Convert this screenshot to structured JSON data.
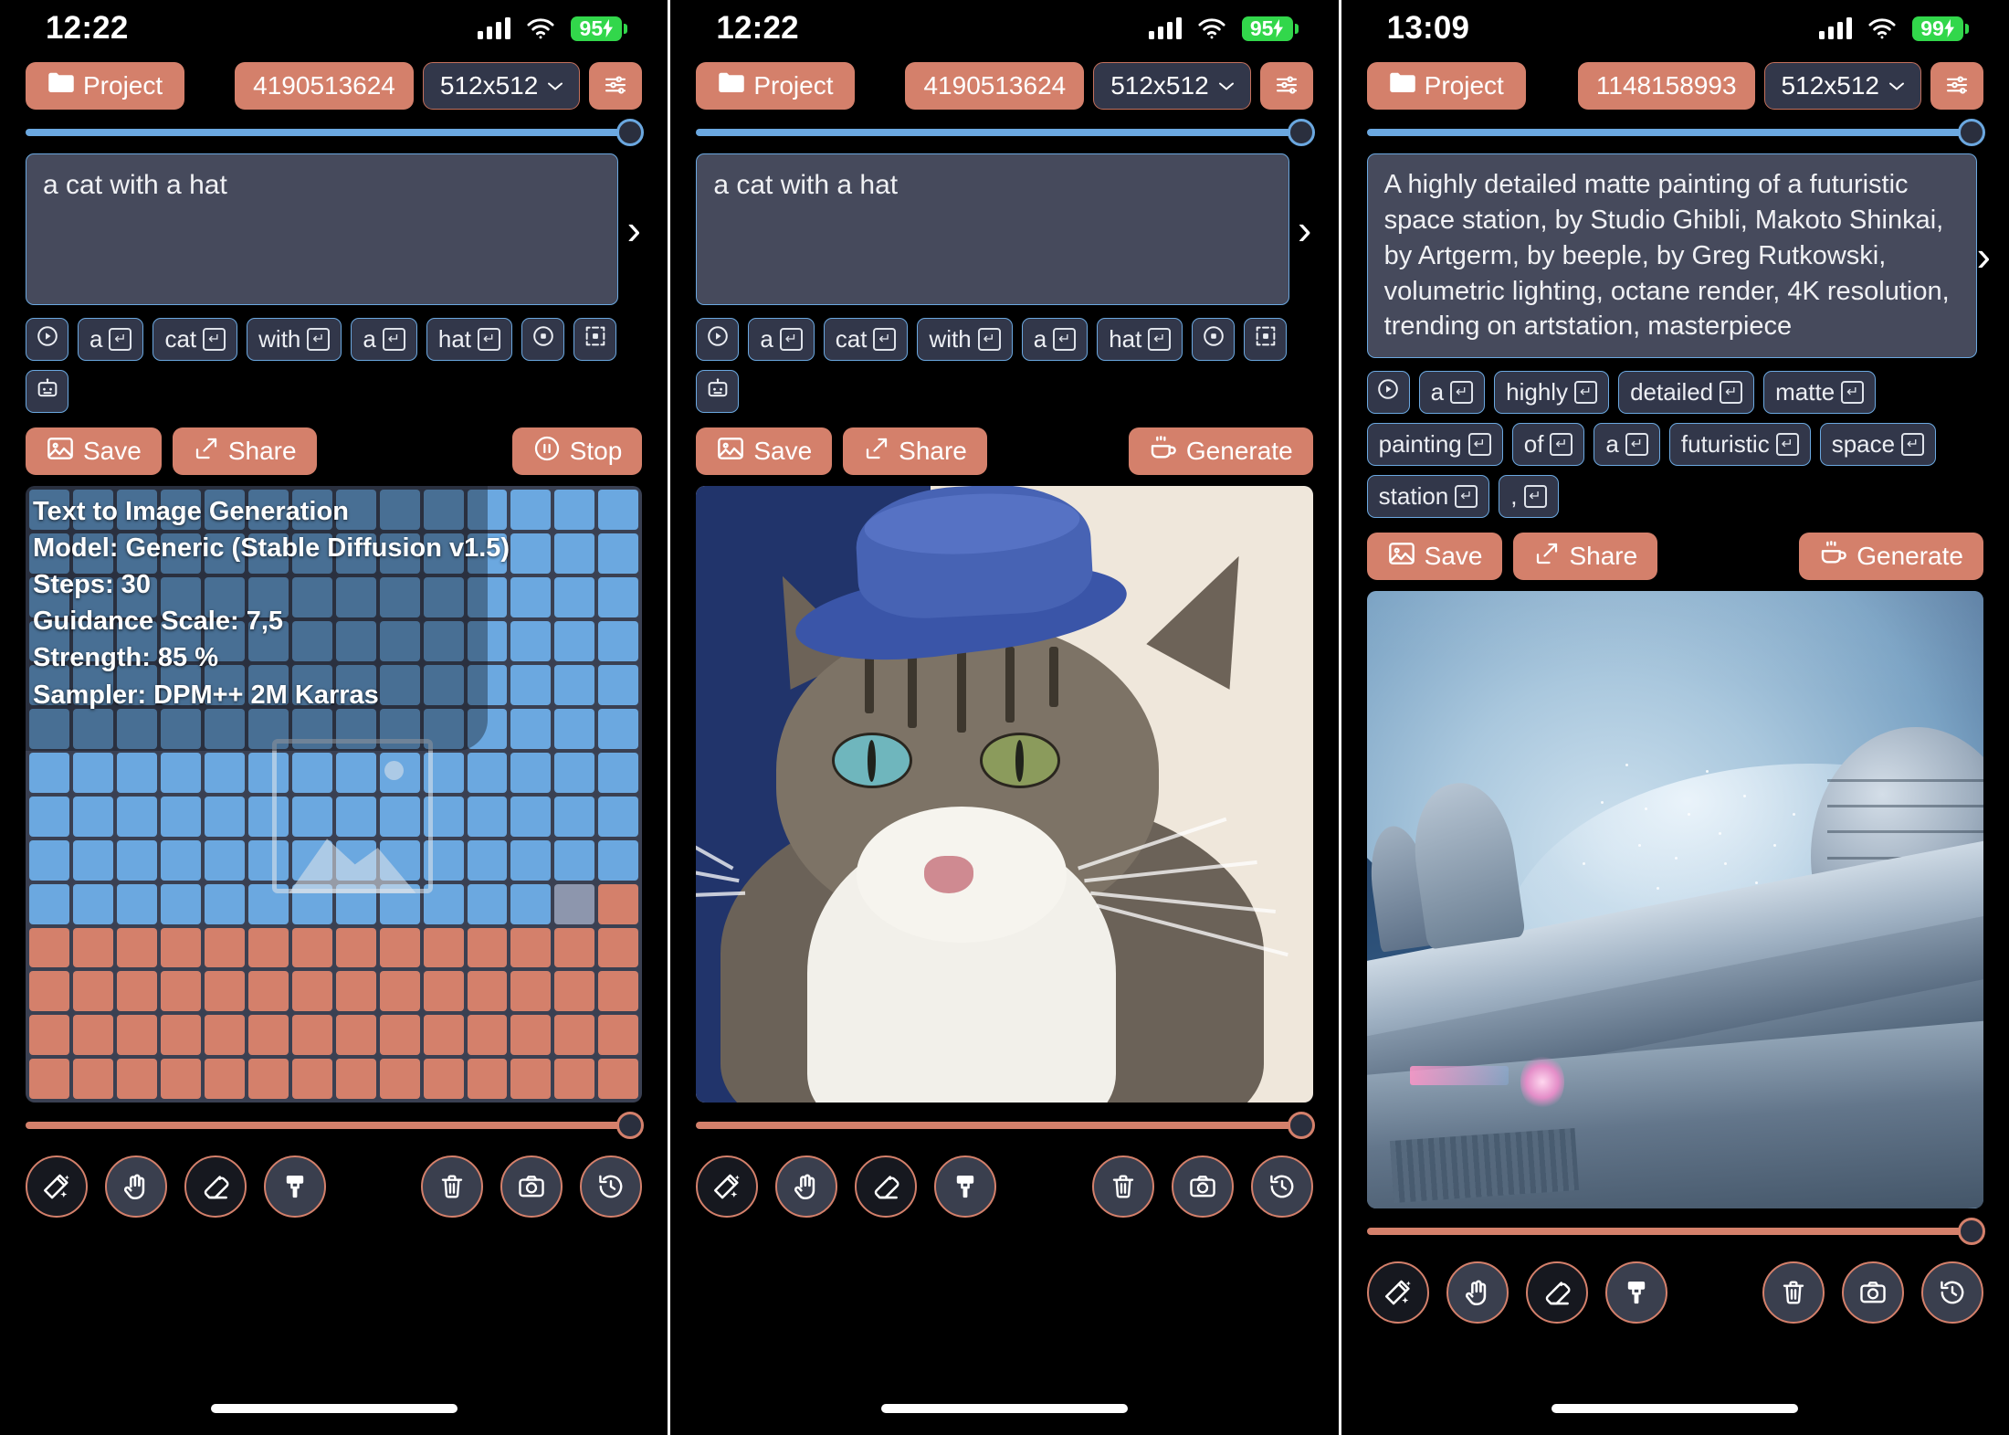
{
  "accent": "#d4806b",
  "accent_blue": "#6ba8e0",
  "panel_bg": "#32374a",
  "prompt_bg": "#464a5c",
  "battery_green": "#32d74b",
  "labels": {
    "project": "Project",
    "save": "Save",
    "share": "Share",
    "stop": "Stop",
    "generate": "Generate",
    "chev": "⌄",
    "prompt_next_arrow": "›",
    "return_glyph": "↵"
  },
  "screens": [
    {
      "id": "generating",
      "status": {
        "time": "12:22",
        "battery": "95"
      },
      "toolbar": {
        "project": "Project",
        "seed": "4190513624",
        "size": "512x512"
      },
      "strength_slider": {
        "value": 100
      },
      "prompt": {
        "text": "a cat with a hat",
        "placeholder": "Enter a prompt"
      },
      "tokens": [
        {
          "label": "",
          "icon": "play-circle-icon"
        },
        {
          "label": "a",
          "icon": "return-icon"
        },
        {
          "label": "cat",
          "icon": "return-icon"
        },
        {
          "label": "with",
          "icon": "return-icon"
        },
        {
          "label": "a",
          "icon": "return-icon"
        },
        {
          "label": "hat",
          "icon": "return-icon"
        },
        {
          "label": "",
          "icon": "record-circle-icon"
        },
        {
          "label": "",
          "icon": "crop-icon"
        },
        {
          "label": "",
          "icon": "robot-icon"
        }
      ],
      "actions": {
        "save": "Save",
        "share": "Share",
        "primary": "Stop",
        "primary_icon": "pause-icon"
      },
      "canvas": {
        "mode": "progress-grid",
        "info": [
          "Text to Image Generation",
          "Model: Generic (Stable Diffusion v1.5)",
          "Steps: 30",
          "Guidance Scale: 7,5",
          "Strength: 85 %",
          "Sampler: DPM++ 2M Karras"
        ],
        "grid": {
          "cols": 14,
          "rows": 14,
          "done_rows": 10,
          "progress_percent": 71
        }
      },
      "progress_slider": {
        "value": 100
      }
    },
    {
      "id": "cat-result",
      "status": {
        "time": "12:22",
        "battery": "95"
      },
      "toolbar": {
        "project": "Project",
        "seed": "4190513624",
        "size": "512x512"
      },
      "strength_slider": {
        "value": 100
      },
      "prompt": {
        "text": "a cat with a hat",
        "placeholder": "Enter a prompt"
      },
      "tokens": [
        {
          "label": "",
          "icon": "play-circle-icon"
        },
        {
          "label": "a",
          "icon": "return-icon"
        },
        {
          "label": "cat",
          "icon": "return-icon"
        },
        {
          "label": "with",
          "icon": "return-icon"
        },
        {
          "label": "a",
          "icon": "return-icon"
        },
        {
          "label": "hat",
          "icon": "return-icon"
        },
        {
          "label": "",
          "icon": "record-circle-icon"
        },
        {
          "label": "",
          "icon": "crop-icon"
        },
        {
          "label": "",
          "icon": "robot-icon"
        }
      ],
      "actions": {
        "save": "Save",
        "share": "Share",
        "primary": "Generate",
        "primary_icon": "coffee-icon"
      },
      "canvas": {
        "mode": "image-cat",
        "alt": "A tabby cat wearing a small blue felt top hat"
      },
      "progress_slider": {
        "value": 100
      }
    },
    {
      "id": "space-station-result",
      "status": {
        "time": "13:09",
        "battery": "99"
      },
      "toolbar": {
        "project": "Project",
        "seed": "1148158993",
        "size": "512x512"
      },
      "strength_slider": {
        "value": 100
      },
      "prompt": {
        "text": "A highly detailed matte painting of a futuristic space station, by Studio Ghibli, Makoto Shinkai, by Artgerm, by beeple, by Greg Rutkowski, volumetric lighting, octane render, 4K resolution, trending on artstation, masterpiece",
        "placeholder": "Enter a prompt"
      },
      "tokens": [
        {
          "label": "",
          "icon": "play-circle-icon"
        },
        {
          "label": "a",
          "icon": "return-icon"
        },
        {
          "label": "highly",
          "icon": "return-icon"
        },
        {
          "label": "detailed",
          "icon": "return-icon"
        },
        {
          "label": "matte",
          "icon": "return-icon"
        },
        {
          "label": "painting",
          "icon": "return-icon"
        },
        {
          "label": "of",
          "icon": "return-icon"
        },
        {
          "label": "a",
          "icon": "return-icon"
        },
        {
          "label": "futuristic",
          "icon": "return-icon"
        },
        {
          "label": "space",
          "icon": "return-icon"
        },
        {
          "label": "station",
          "icon": "return-icon"
        },
        {
          "label": ",",
          "icon": "return-icon"
        }
      ],
      "actions": {
        "save": "Save",
        "share": "Share",
        "primary": "Generate",
        "primary_icon": "coffee-icon"
      },
      "canvas": {
        "mode": "image-space",
        "alt": "Futuristic space station hull with a large icy planet behind it"
      },
      "progress_slider": {
        "value": 100
      }
    }
  ],
  "bottom_tools": [
    {
      "name": "magic-wand-icon",
      "dark": true
    },
    {
      "name": "hand-icon",
      "dark": false
    },
    {
      "name": "eraser-icon",
      "dark": true
    },
    {
      "name": "brush-icon",
      "dark": false
    }
  ],
  "bottom_tools_right": [
    {
      "name": "trash-icon",
      "dark": false
    },
    {
      "name": "camera-icon",
      "dark": false
    },
    {
      "name": "history-icon",
      "dark": false
    }
  ]
}
